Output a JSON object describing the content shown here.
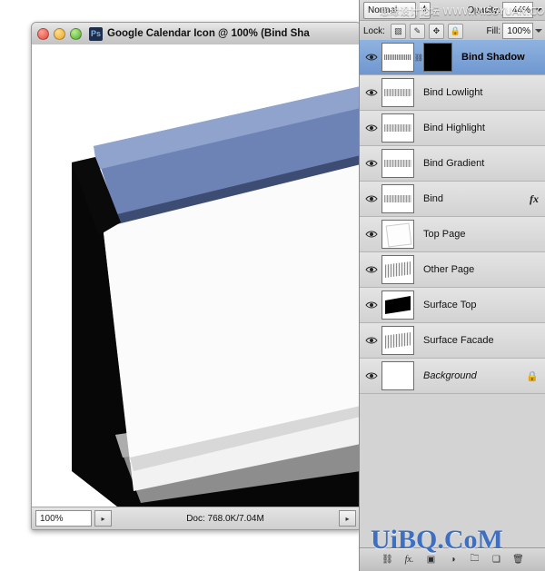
{
  "document_window": {
    "title": "Google Calendar Icon @ 100% (Bind Sha",
    "app_badge": "Ps",
    "traffic_lights": [
      "close",
      "minimize",
      "zoom"
    ],
    "status": {
      "zoom": "100%",
      "doc_info": "Doc: 768.0K/7.04M",
      "left_arrow_glyph": "▸",
      "right_arrow_glyph": "▸"
    }
  },
  "layers_panel": {
    "blend_mode": "Normal",
    "opacity_label": "Opacity:",
    "opacity_value": "44%",
    "lock_label": "Lock:",
    "lock_buttons": [
      "lock-transparent",
      "lock-image",
      "lock-position",
      "lock-all"
    ],
    "fill_label": "Fill:",
    "fill_value": "100%",
    "layers": [
      {
        "name": "Bind Shadow",
        "visible": true,
        "selected": true,
        "has_mask": true,
        "has_fx": false,
        "locked": false,
        "italic": false,
        "thumb": "stripe-mask"
      },
      {
        "name": "Bind Lowlight",
        "visible": true,
        "selected": false,
        "has_mask": false,
        "has_fx": false,
        "locked": false,
        "italic": false,
        "thumb": "stripe"
      },
      {
        "name": "Bind Highlight",
        "visible": true,
        "selected": false,
        "has_mask": false,
        "has_fx": false,
        "locked": false,
        "italic": false,
        "thumb": "stripe"
      },
      {
        "name": "Bind Gradient",
        "visible": true,
        "selected": false,
        "has_mask": false,
        "has_fx": false,
        "locked": false,
        "italic": false,
        "thumb": "stripe"
      },
      {
        "name": "Bind",
        "visible": true,
        "selected": false,
        "has_mask": false,
        "has_fx": true,
        "locked": false,
        "italic": false,
        "thumb": "stripe"
      },
      {
        "name": "Top Page",
        "visible": true,
        "selected": false,
        "has_mask": false,
        "has_fx": false,
        "locked": false,
        "italic": false,
        "thumb": "page"
      },
      {
        "name": "Other Page",
        "visible": true,
        "selected": false,
        "has_mask": false,
        "has_fx": false,
        "locked": false,
        "italic": false,
        "thumb": "gray-poly"
      },
      {
        "name": "Surface Top",
        "visible": true,
        "selected": false,
        "has_mask": false,
        "has_fx": false,
        "locked": false,
        "italic": false,
        "thumb": "black-poly"
      },
      {
        "name": "Surface Facade",
        "visible": true,
        "selected": false,
        "has_mask": false,
        "has_fx": false,
        "locked": false,
        "italic": false,
        "thumb": "gray-poly"
      },
      {
        "name": "Background",
        "visible": true,
        "selected": false,
        "has_mask": false,
        "has_fx": false,
        "locked": true,
        "italic": true,
        "thumb": "white"
      }
    ],
    "bottom_buttons": [
      "link-layers",
      "add-layer-style",
      "add-layer-mask",
      "new-group",
      "new-adjustment-layer",
      "new-layer",
      "delete-layer"
    ],
    "bottom_glyphs": [
      "⚭",
      "fx.",
      "□",
      "▢",
      "◐",
      "❐",
      "⌫"
    ]
  },
  "watermarks": {
    "top": "思缘设计论坛 WWW.MISSYUAN.COM",
    "bottom": "UiBQ.CoM"
  },
  "colors": {
    "selection_blue": "#7f9fd1",
    "bind_blue": "#6e83b5",
    "watermark_blue": "#3f6fc0",
    "panel_gray": "#d3d3d3"
  }
}
